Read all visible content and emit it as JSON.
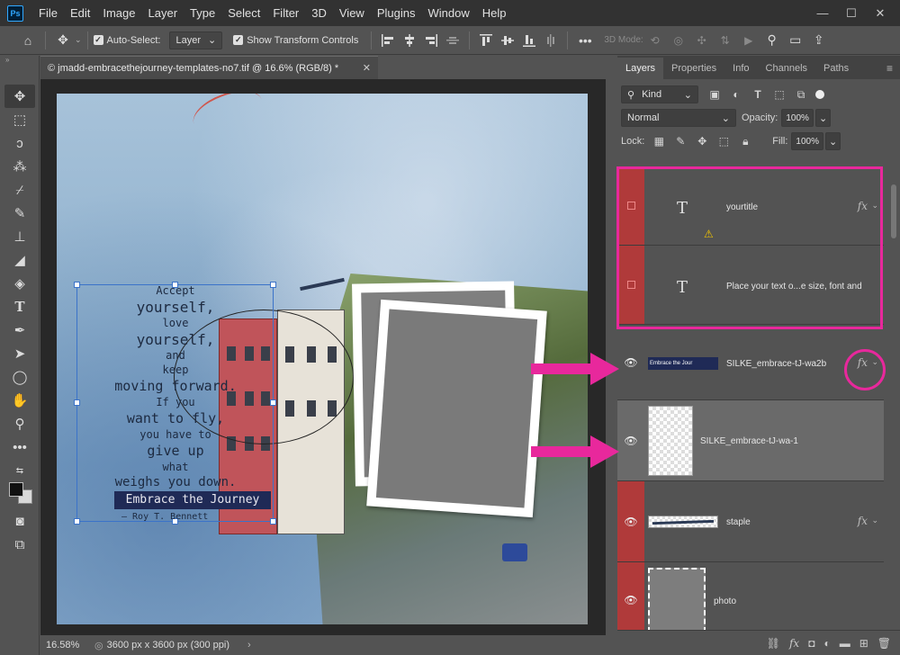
{
  "app": {
    "logo": "Ps"
  },
  "menu": [
    "File",
    "Edit",
    "Image",
    "Layer",
    "Type",
    "Select",
    "Filter",
    "3D",
    "View",
    "Plugins",
    "Window",
    "Help"
  ],
  "window_controls": [
    "―",
    "☐",
    "✕"
  ],
  "options": {
    "auto_select_label": "Auto-Select:",
    "auto_select_value": "Layer",
    "show_transform_label": "Show Transform Controls",
    "mode_3d_label": "3D Mode:"
  },
  "document": {
    "tab_title": "© jmadd-embracethejourney-templates-no7.tif @ 16.6% (RGB/8) *",
    "zoom": "16.58%",
    "dimensions": "3600 px x 3600 px (300 ppi)"
  },
  "quote": {
    "lines": [
      "Accept",
      "yourself,",
      "love",
      "yourself,",
      "and",
      "keep",
      "moving forward.",
      "If you",
      "want to fly,",
      "you have to",
      "give up",
      "what",
      "weighs you down."
    ],
    "banner": "Embrace the Journey",
    "author": "– Roy T. Bennett"
  },
  "panel": {
    "tabs": [
      "Layers",
      "Properties",
      "Info",
      "Channels",
      "Paths"
    ],
    "filter_kind": "Kind",
    "blend_mode": "Normal",
    "opacity_label": "Opacity:",
    "opacity_value": "100%",
    "lock_label": "Lock:",
    "fill_label": "Fill:",
    "fill_value": "100%",
    "layers": [
      {
        "name": "yourtitle",
        "type_icon": "T",
        "fx": "fx"
      },
      {
        "name": "Place your text o...e size, font and",
        "type_icon": "T"
      },
      {
        "name": "SILKE_embrace-tJ-wa2b",
        "thumb_text": "Embrace the Jour",
        "fx": "fx"
      },
      {
        "name": "SILKE_embrace-tJ-wa-1"
      },
      {
        "name": "staple",
        "fx": "fx"
      },
      {
        "name": "photo"
      }
    ]
  },
  "colors": {
    "highlight": "#e8289c",
    "panel_bg": "#535353",
    "red_vis": "#b03a3a"
  }
}
